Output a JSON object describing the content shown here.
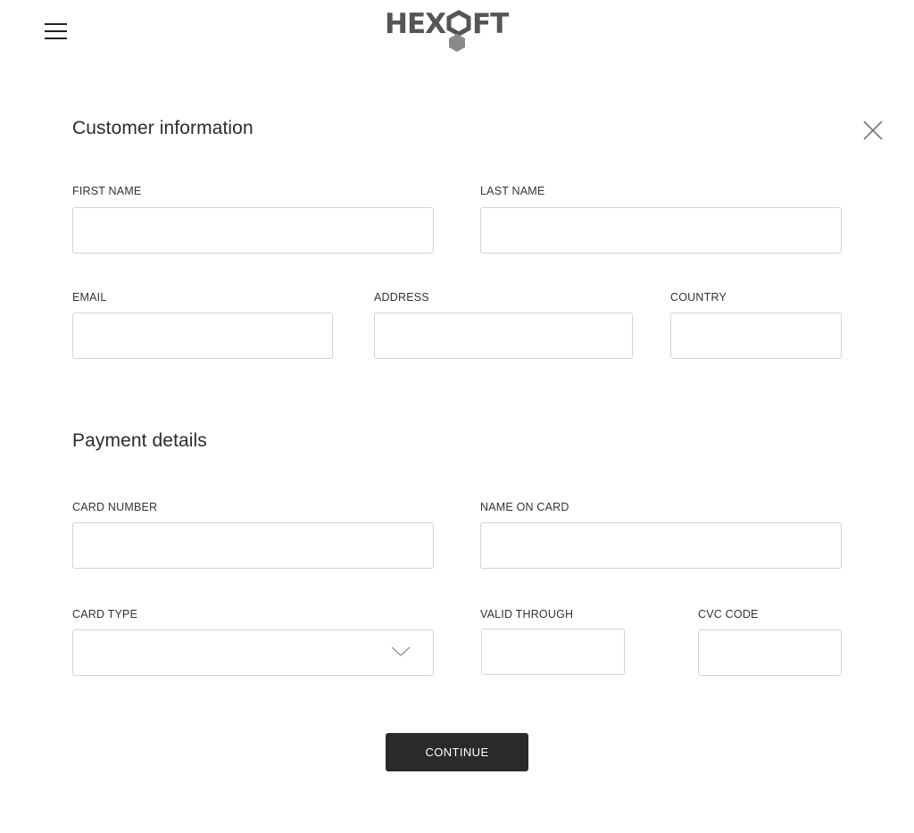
{
  "header": {
    "menu_icon": "hamburger-menu-icon",
    "logo_text": "HEXOFT",
    "logo_color": "#555555"
  },
  "customer": {
    "title": "Customer information",
    "first_name_label": "FIRST NAME",
    "first_name_value": "",
    "last_name_label": "LAST NAME",
    "last_name_value": "",
    "email_label": "EMAIL",
    "email_value": "",
    "address_label": "ADDRESS",
    "address_value": "",
    "country_label": "COUNTRY",
    "country_value": ""
  },
  "payment": {
    "title": "Payment details",
    "card_number_label": "CARD NUMBER",
    "card_number_value": "",
    "name_on_card_label": "NAME ON CARD",
    "name_on_card_value": "",
    "card_type_label": "CARD TYPE",
    "card_type_value": "",
    "valid_through_label": "VALID THROUGH",
    "valid_through_value": "",
    "cvc_label": "CVC CODE",
    "cvc_value": ""
  },
  "actions": {
    "continue_label": "CONTINUE",
    "close_icon": "close-icon"
  },
  "colors": {
    "button_bg": "#2a2a2a",
    "border": "#d4d4d4",
    "text": "#2b2b2b"
  }
}
